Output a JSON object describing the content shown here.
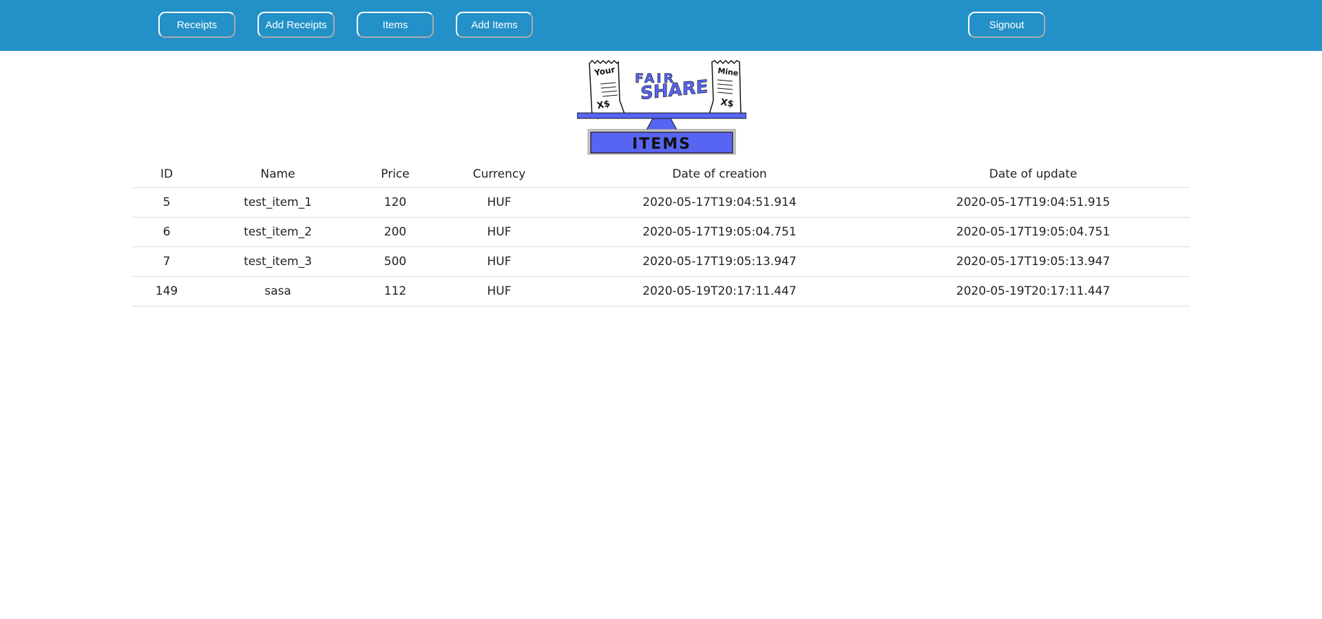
{
  "nav": {
    "receipts": "Receipts",
    "add_receipts": "Add Receipts",
    "items": "Items",
    "add_items": "Add Items",
    "signout": "Signout"
  },
  "logo": {
    "fair": "FAIR",
    "share": "SHARE",
    "caption": "ITEMS",
    "left_receipt": "Your",
    "right_receipt": "Mine",
    "receipt_amount": "X$"
  },
  "table": {
    "headers": [
      "ID",
      "Name",
      "Price",
      "Currency",
      "Date of creation",
      "Date of update"
    ],
    "rows": [
      [
        "5",
        "test_item_1",
        "120",
        "HUF",
        "2020-05-17T19:04:51.914",
        "2020-05-17T19:04:51.915"
      ],
      [
        "6",
        "test_item_2",
        "200",
        "HUF",
        "2020-05-17T19:05:04.751",
        "2020-05-17T19:05:04.751"
      ],
      [
        "7",
        "test_item_3",
        "500",
        "HUF",
        "2020-05-17T19:05:13.947",
        "2020-05-17T19:05:13.947"
      ],
      [
        "149",
        "sasa",
        "112",
        "HUF",
        "2020-05-19T20:17:11.447",
        "2020-05-19T20:17:11.447"
      ]
    ]
  },
  "colors": {
    "header_bar": "#2391c8",
    "logo_blue": "#5865f2"
  }
}
